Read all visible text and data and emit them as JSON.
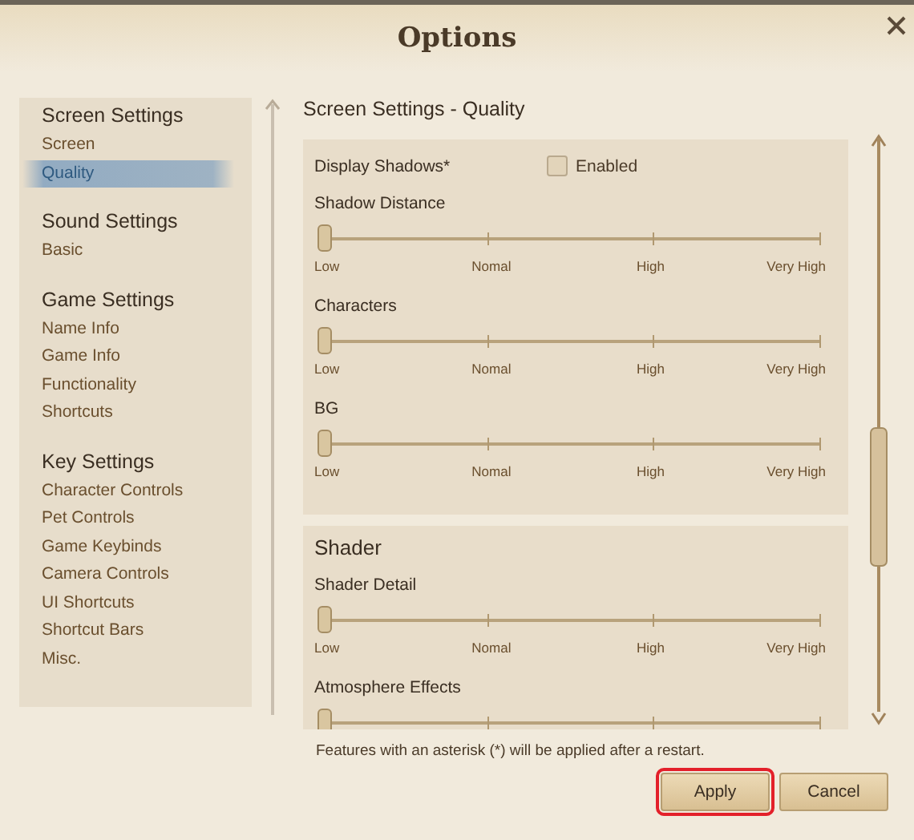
{
  "window": {
    "title": "Options"
  },
  "nav": {
    "groups": [
      {
        "heading": "Screen Settings",
        "items": [
          {
            "label": "Screen",
            "selected": false
          },
          {
            "label": "Quality",
            "selected": true
          }
        ]
      },
      {
        "heading": "Sound Settings",
        "items": [
          {
            "label": "Basic",
            "selected": false
          }
        ]
      },
      {
        "heading": "Game Settings",
        "items": [
          {
            "label": "Name Info",
            "selected": false
          },
          {
            "label": "Game Info",
            "selected": false
          },
          {
            "label": "Functionality",
            "selected": false
          },
          {
            "label": "Shortcuts",
            "selected": false
          }
        ]
      },
      {
        "heading": "Key Settings",
        "items": [
          {
            "label": "Character Controls",
            "selected": false
          },
          {
            "label": "Pet Controls",
            "selected": false
          },
          {
            "label": "Game Keybinds",
            "selected": false
          },
          {
            "label": "Camera Controls",
            "selected": false
          },
          {
            "label": "UI Shortcuts",
            "selected": false
          },
          {
            "label": "Shortcut Bars",
            "selected": false
          },
          {
            "label": "Misc.",
            "selected": false
          }
        ]
      }
    ]
  },
  "content": {
    "title": "Screen Settings - Quality",
    "sections": [
      {
        "items": [
          {
            "kind": "checkbox",
            "label": "Display Shadows*",
            "option": "Enabled",
            "checked": false
          },
          {
            "kind": "slider",
            "label": "Shadow Distance",
            "level": 0,
            "ticks": [
              "Low",
              "Nomal",
              "High",
              "Very High"
            ]
          },
          {
            "kind": "slider",
            "label": "Characters",
            "level": 0,
            "ticks": [
              "Low",
              "Nomal",
              "High",
              "Very High"
            ]
          },
          {
            "kind": "slider",
            "label": "BG",
            "level": 0,
            "ticks": [
              "Low",
              "Nomal",
              "High",
              "Very High"
            ]
          }
        ]
      },
      {
        "heading": "Shader",
        "items": [
          {
            "kind": "slider",
            "label": "Shader Detail",
            "level": 0,
            "ticks": [
              "Low",
              "Nomal",
              "High",
              "Very High"
            ]
          },
          {
            "kind": "slider",
            "label": "Atmosphere Effects",
            "level": 0
          }
        ]
      }
    ]
  },
  "note": "Features with an asterisk (*) will be applied after a restart.",
  "buttons": [
    {
      "label": "Apply",
      "highlighted": true
    },
    {
      "label": "Cancel",
      "highlighted": false
    }
  ]
}
